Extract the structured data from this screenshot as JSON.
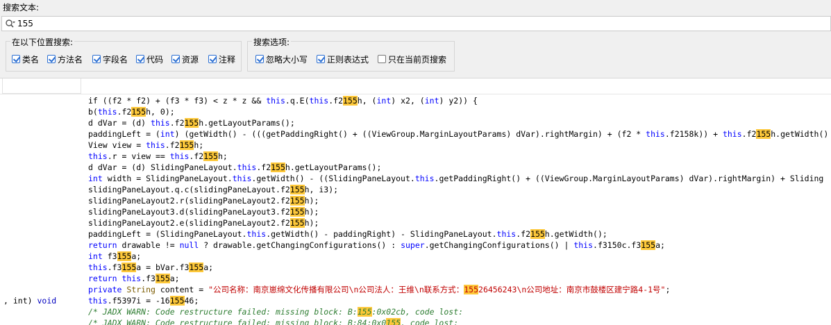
{
  "search": {
    "label": "搜索文本:",
    "value": "155"
  },
  "location_group": {
    "title": "在以下位置搜索:",
    "options": [
      {
        "label": "类名",
        "checked": true
      },
      {
        "label": "方法名",
        "checked": true
      },
      {
        "label": "字段名",
        "checked": true
      },
      {
        "label": "代码",
        "checked": true
      },
      {
        "label": "资源",
        "checked": true
      },
      {
        "label": "注释",
        "checked": true
      }
    ]
  },
  "options_group": {
    "title": "搜索选项:",
    "options": [
      {
        "label": "忽略大小写",
        "checked": true
      },
      {
        "label": "正则表达式",
        "checked": true
      },
      {
        "label": "只在当前页搜索",
        "checked": false
      }
    ]
  },
  "results": {
    "left_signature": ", int) ",
    "left_signature_type": "void",
    "lines": [
      [
        [
          "if ((f2 * f2) + (f3 * f3) < z * z && ",
          "t"
        ],
        [
          "this",
          "k"
        ],
        [
          ".q.E(",
          "t"
        ],
        [
          "this",
          "k"
        ],
        [
          ".f2",
          "t"
        ],
        [
          "155",
          "h"
        ],
        [
          "h, (",
          "t"
        ],
        [
          "int",
          "k"
        ],
        [
          ") x2, (",
          "t"
        ],
        [
          "int",
          "k"
        ],
        [
          ") y2)) {",
          "t"
        ]
      ],
      [
        [
          "b(",
          "t"
        ],
        [
          "this",
          "k"
        ],
        [
          ".f2",
          "t"
        ],
        [
          "155",
          "h"
        ],
        [
          "h, 0);",
          "t"
        ]
      ],
      [
        [
          "d dVar = (d) ",
          "t"
        ],
        [
          "this",
          "k"
        ],
        [
          ".f2",
          "t"
        ],
        [
          "155",
          "h"
        ],
        [
          "h.getLayoutParams();",
          "t"
        ]
      ],
      [
        [
          "paddingLeft = (",
          "t"
        ],
        [
          "int",
          "k"
        ],
        [
          ") (getWidth() - (((getPaddingRight() + ((ViewGroup.MarginLayoutParams) dVar).rightMargin) + (f2 * ",
          "t"
        ],
        [
          "this",
          "k"
        ],
        [
          ".f2158k)) + ",
          "t"
        ],
        [
          "this",
          "k"
        ],
        [
          ".f2",
          "t"
        ],
        [
          "155",
          "h"
        ],
        [
          "h.getWidth()",
          "t"
        ]
      ],
      [
        [
          "View view = ",
          "t"
        ],
        [
          "this",
          "k"
        ],
        [
          ".f2",
          "t"
        ],
        [
          "155",
          "h"
        ],
        [
          "h;",
          "t"
        ]
      ],
      [
        [
          "this",
          "k"
        ],
        [
          ".r = view == ",
          "t"
        ],
        [
          "this",
          "k"
        ],
        [
          ".f2",
          "t"
        ],
        [
          "155",
          "h"
        ],
        [
          "h;",
          "t"
        ]
      ],
      [
        [
          "d dVar = (d) SlidingPaneLayout.",
          "t"
        ],
        [
          "this",
          "k"
        ],
        [
          ".f2",
          "t"
        ],
        [
          "155",
          "h"
        ],
        [
          "h.getLayoutParams();",
          "t"
        ]
      ],
      [
        [
          "int",
          "k"
        ],
        [
          " width = SlidingPaneLayout.",
          "t"
        ],
        [
          "this",
          "k"
        ],
        [
          ".getWidth() - ((SlidingPaneLayout.",
          "t"
        ],
        [
          "this",
          "k"
        ],
        [
          ".getPaddingRight() + ((ViewGroup.MarginLayoutParams) dVar).rightMargin) + Sliding",
          "t"
        ]
      ],
      [
        [
          "slidingPaneLayout.q.c(slidingPaneLayout.f2",
          "t"
        ],
        [
          "155",
          "h"
        ],
        [
          "h, i3);",
          "t"
        ]
      ],
      [
        [
          "slidingPaneLayout2.r(slidingPaneLayout2.f2",
          "t"
        ],
        [
          "155",
          "h"
        ],
        [
          "h);",
          "t"
        ]
      ],
      [
        [
          "slidingPaneLayout3.d(slidingPaneLayout3.f2",
          "t"
        ],
        [
          "155",
          "h"
        ],
        [
          "h);",
          "t"
        ]
      ],
      [
        [
          "slidingPaneLayout2.e(slidingPaneLayout2.f2",
          "t"
        ],
        [
          "155",
          "h"
        ],
        [
          "h);",
          "t"
        ]
      ],
      [
        [
          "paddingLeft = (SlidingPaneLayout.",
          "t"
        ],
        [
          "this",
          "k"
        ],
        [
          ".getWidth() - paddingRight) - SlidingPaneLayout.",
          "t"
        ],
        [
          "this",
          "k"
        ],
        [
          ".f2",
          "t"
        ],
        [
          "155",
          "h"
        ],
        [
          "h.getWidth();",
          "t"
        ]
      ],
      [
        [
          "return",
          "k"
        ],
        [
          " drawable != ",
          "t"
        ],
        [
          "null",
          "k"
        ],
        [
          " ? drawable.getChangingConfigurations() : ",
          "t"
        ],
        [
          "super",
          "k"
        ],
        [
          ".getChangingConfigurations() | ",
          "t"
        ],
        [
          "this",
          "k"
        ],
        [
          ".f3150c.f3",
          "t"
        ],
        [
          "155",
          "h"
        ],
        [
          "a;",
          "t"
        ]
      ],
      [
        [
          "int",
          "k"
        ],
        [
          " f3",
          "t"
        ],
        [
          "155",
          "h"
        ],
        [
          "a;",
          "t"
        ]
      ],
      [
        [
          "this",
          "k"
        ],
        [
          ".f3",
          "t"
        ],
        [
          "155",
          "h"
        ],
        [
          "a = bVar.f3",
          "t"
        ],
        [
          "155",
          "h"
        ],
        [
          "a;",
          "t"
        ]
      ],
      [
        [
          "return",
          "k"
        ],
        [
          " ",
          "t"
        ],
        [
          "this",
          "k"
        ],
        [
          ".f3",
          "t"
        ],
        [
          "155",
          "h"
        ],
        [
          "a;",
          "t"
        ]
      ],
      [
        [
          "private",
          "k"
        ],
        [
          " ",
          "t"
        ],
        [
          "String",
          "y"
        ],
        [
          " content = ",
          "t"
        ],
        [
          "\"公司名称：南京崽绵文化传播有限公司\\n公司法人：王维\\n联系方式：",
          "s"
        ],
        [
          "155",
          "hs"
        ],
        [
          "26456243\\n公司地址：南京市鼓楼区建宁路4-1号\"",
          "s"
        ],
        [
          ";",
          "t"
        ]
      ],
      [
        [
          "this",
          "k"
        ],
        [
          ".f5397i = -16",
          "t"
        ],
        [
          "155",
          "h"
        ],
        [
          "46;",
          "t"
        ]
      ],
      [
        [
          "/* JADX WARN: Code restructure failed: missing block: B:",
          "c"
        ],
        [
          "155",
          "hc"
        ],
        [
          ":0x02cb, code lost:",
          "c"
        ]
      ],
      [
        [
          "/* JADX WARN: Code restructure failed: missing block: B:84:0x0",
          "c"
        ],
        [
          "155",
          "hc"
        ],
        [
          ", code lost:",
          "c"
        ]
      ]
    ]
  }
}
